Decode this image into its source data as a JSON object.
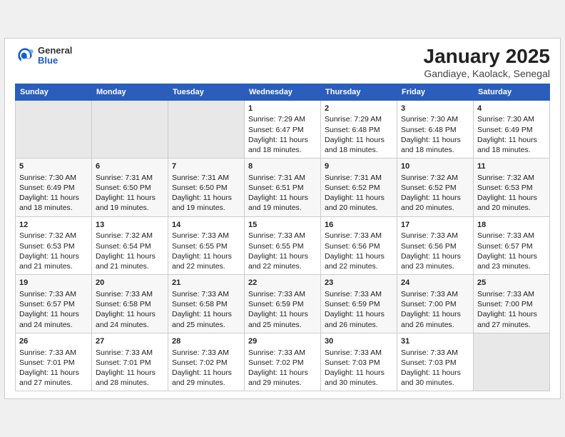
{
  "header": {
    "logo_general": "General",
    "logo_blue": "Blue",
    "title": "January 2025",
    "subtitle": "Gandiaye, Kaolack, Senegal"
  },
  "days_of_week": [
    "Sunday",
    "Monday",
    "Tuesday",
    "Wednesday",
    "Thursday",
    "Friday",
    "Saturday"
  ],
  "weeks": [
    [
      {
        "day": "",
        "text": ""
      },
      {
        "day": "",
        "text": ""
      },
      {
        "day": "",
        "text": ""
      },
      {
        "day": "1",
        "text": "Sunrise: 7:29 AM\nSunset: 6:47 PM\nDaylight: 11 hours and 18 minutes."
      },
      {
        "day": "2",
        "text": "Sunrise: 7:29 AM\nSunset: 6:48 PM\nDaylight: 11 hours and 18 minutes."
      },
      {
        "day": "3",
        "text": "Sunrise: 7:30 AM\nSunset: 6:48 PM\nDaylight: 11 hours and 18 minutes."
      },
      {
        "day": "4",
        "text": "Sunrise: 7:30 AM\nSunset: 6:49 PM\nDaylight: 11 hours and 18 minutes."
      }
    ],
    [
      {
        "day": "5",
        "text": "Sunrise: 7:30 AM\nSunset: 6:49 PM\nDaylight: 11 hours and 18 minutes."
      },
      {
        "day": "6",
        "text": "Sunrise: 7:31 AM\nSunset: 6:50 PM\nDaylight: 11 hours and 19 minutes."
      },
      {
        "day": "7",
        "text": "Sunrise: 7:31 AM\nSunset: 6:50 PM\nDaylight: 11 hours and 19 minutes."
      },
      {
        "day": "8",
        "text": "Sunrise: 7:31 AM\nSunset: 6:51 PM\nDaylight: 11 hours and 19 minutes."
      },
      {
        "day": "9",
        "text": "Sunrise: 7:31 AM\nSunset: 6:52 PM\nDaylight: 11 hours and 20 minutes."
      },
      {
        "day": "10",
        "text": "Sunrise: 7:32 AM\nSunset: 6:52 PM\nDaylight: 11 hours and 20 minutes."
      },
      {
        "day": "11",
        "text": "Sunrise: 7:32 AM\nSunset: 6:53 PM\nDaylight: 11 hours and 20 minutes."
      }
    ],
    [
      {
        "day": "12",
        "text": "Sunrise: 7:32 AM\nSunset: 6:53 PM\nDaylight: 11 hours and 21 minutes."
      },
      {
        "day": "13",
        "text": "Sunrise: 7:32 AM\nSunset: 6:54 PM\nDaylight: 11 hours and 21 minutes."
      },
      {
        "day": "14",
        "text": "Sunrise: 7:33 AM\nSunset: 6:55 PM\nDaylight: 11 hours and 22 minutes."
      },
      {
        "day": "15",
        "text": "Sunrise: 7:33 AM\nSunset: 6:55 PM\nDaylight: 11 hours and 22 minutes."
      },
      {
        "day": "16",
        "text": "Sunrise: 7:33 AM\nSunset: 6:56 PM\nDaylight: 11 hours and 22 minutes."
      },
      {
        "day": "17",
        "text": "Sunrise: 7:33 AM\nSunset: 6:56 PM\nDaylight: 11 hours and 23 minutes."
      },
      {
        "day": "18",
        "text": "Sunrise: 7:33 AM\nSunset: 6:57 PM\nDaylight: 11 hours and 23 minutes."
      }
    ],
    [
      {
        "day": "19",
        "text": "Sunrise: 7:33 AM\nSunset: 6:57 PM\nDaylight: 11 hours and 24 minutes."
      },
      {
        "day": "20",
        "text": "Sunrise: 7:33 AM\nSunset: 6:58 PM\nDaylight: 11 hours and 24 minutes."
      },
      {
        "day": "21",
        "text": "Sunrise: 7:33 AM\nSunset: 6:58 PM\nDaylight: 11 hours and 25 minutes."
      },
      {
        "day": "22",
        "text": "Sunrise: 7:33 AM\nSunset: 6:59 PM\nDaylight: 11 hours and 25 minutes."
      },
      {
        "day": "23",
        "text": "Sunrise: 7:33 AM\nSunset: 6:59 PM\nDaylight: 11 hours and 26 minutes."
      },
      {
        "day": "24",
        "text": "Sunrise: 7:33 AM\nSunset: 7:00 PM\nDaylight: 11 hours and 26 minutes."
      },
      {
        "day": "25",
        "text": "Sunrise: 7:33 AM\nSunset: 7:00 PM\nDaylight: 11 hours and 27 minutes."
      }
    ],
    [
      {
        "day": "26",
        "text": "Sunrise: 7:33 AM\nSunset: 7:01 PM\nDaylight: 11 hours and 27 minutes."
      },
      {
        "day": "27",
        "text": "Sunrise: 7:33 AM\nSunset: 7:01 PM\nDaylight: 11 hours and 28 minutes."
      },
      {
        "day": "28",
        "text": "Sunrise: 7:33 AM\nSunset: 7:02 PM\nDaylight: 11 hours and 29 minutes."
      },
      {
        "day": "29",
        "text": "Sunrise: 7:33 AM\nSunset: 7:02 PM\nDaylight: 11 hours and 29 minutes."
      },
      {
        "day": "30",
        "text": "Sunrise: 7:33 AM\nSunset: 7:03 PM\nDaylight: 11 hours and 30 minutes."
      },
      {
        "day": "31",
        "text": "Sunrise: 7:33 AM\nSunset: 7:03 PM\nDaylight: 11 hours and 30 minutes."
      },
      {
        "day": "",
        "text": ""
      }
    ]
  ]
}
